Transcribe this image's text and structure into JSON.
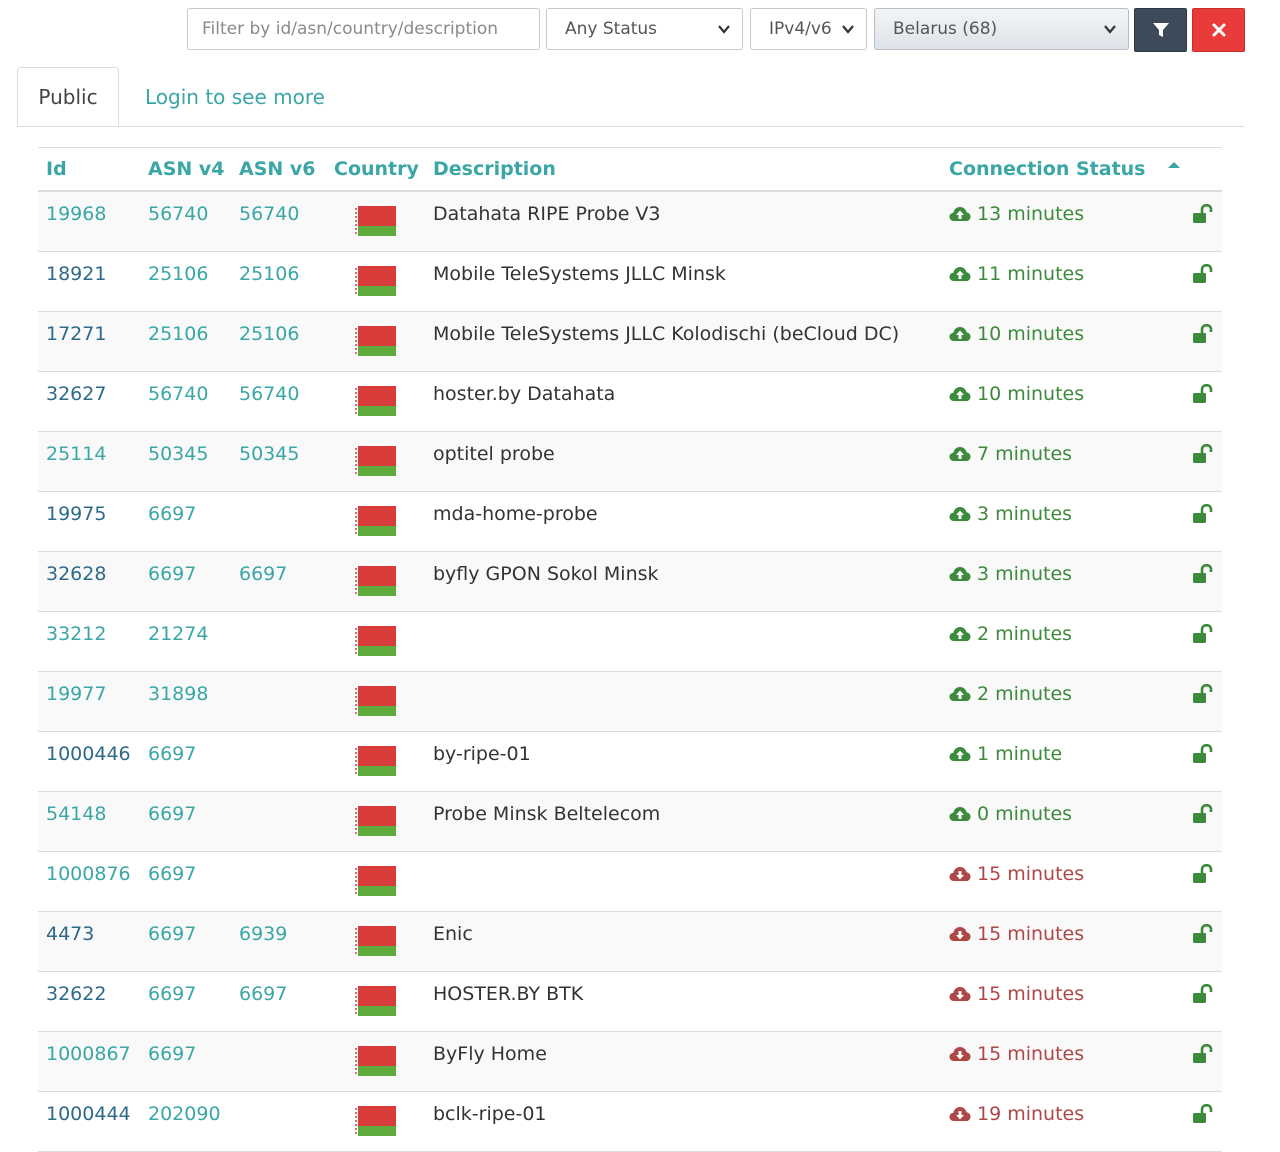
{
  "filters": {
    "search_placeholder": "Filter by id/asn/country/description",
    "status_value": "Any Status",
    "ip_value": "IPv4/v6",
    "country_value": "Belarus (68)"
  },
  "tabs": {
    "public": "Public",
    "login": "Login to see more"
  },
  "table": {
    "headers": {
      "id": "Id",
      "asn_v4": "ASN v4",
      "asn_v6": "ASN v6",
      "country": "Country",
      "description": "Description",
      "connection_status": "Connection Status"
    },
    "rows": [
      {
        "id": "19968",
        "asn_v4": "56740",
        "asn_v6": "56740",
        "description": "Datahata RIPE Probe V3",
        "status": "13 minutes",
        "state": "up",
        "id_style": "light"
      },
      {
        "id": "18921",
        "asn_v4": "25106",
        "asn_v6": "25106",
        "description": "Mobile TeleSystems JLLC Minsk",
        "status": "11 minutes",
        "state": "up",
        "id_style": "dark"
      },
      {
        "id": "17271",
        "asn_v4": "25106",
        "asn_v6": "25106",
        "description": "Mobile TeleSystems JLLC Kolodischi (beCloud DC)",
        "status": "10 minutes",
        "state": "up",
        "id_style": "dark"
      },
      {
        "id": "32627",
        "asn_v4": "56740",
        "asn_v6": "56740",
        "description": "hoster.by Datahata",
        "status": "10 minutes",
        "state": "up",
        "id_style": "dark"
      },
      {
        "id": "25114",
        "asn_v4": "50345",
        "asn_v6": "50345",
        "description": "optitel probe",
        "status": "7 minutes",
        "state": "up",
        "id_style": "light"
      },
      {
        "id": "19975",
        "asn_v4": "6697",
        "asn_v6": "",
        "description": "mda-home-probe",
        "status": "3 minutes",
        "state": "up",
        "id_style": "dark"
      },
      {
        "id": "32628",
        "asn_v4": "6697",
        "asn_v6": "6697",
        "description": "byfly GPON Sokol Minsk",
        "status": "3 minutes",
        "state": "up",
        "id_style": "dark"
      },
      {
        "id": "33212",
        "asn_v4": "21274",
        "asn_v6": "",
        "description": "",
        "status": "2 minutes",
        "state": "up",
        "id_style": "light"
      },
      {
        "id": "19977",
        "asn_v4": "31898",
        "asn_v6": "",
        "description": "",
        "status": "2 minutes",
        "state": "up",
        "id_style": "light"
      },
      {
        "id": "1000446",
        "asn_v4": "6697",
        "asn_v6": "",
        "description": "by-ripe-01",
        "status": "1 minute",
        "state": "up",
        "id_style": "dark"
      },
      {
        "id": "54148",
        "asn_v4": "6697",
        "asn_v6": "",
        "description": "Probe Minsk Beltelecom",
        "status": "0 minutes",
        "state": "up",
        "id_style": "light"
      },
      {
        "id": "1000876",
        "asn_v4": "6697",
        "asn_v6": "",
        "description": "",
        "status": "15 minutes",
        "state": "down",
        "id_style": "light"
      },
      {
        "id": "4473",
        "asn_v4": "6697",
        "asn_v6": "6939",
        "description": "Enic",
        "status": "15 minutes",
        "state": "down",
        "id_style": "dark"
      },
      {
        "id": "32622",
        "asn_v4": "6697",
        "asn_v6": "6697",
        "description": "HOSTER.BY BTK",
        "status": "15 minutes",
        "state": "down",
        "id_style": "dark"
      },
      {
        "id": "1000867",
        "asn_v4": "6697",
        "asn_v6": "",
        "description": "ByFly Home",
        "status": "15 minutes",
        "state": "down",
        "id_style": "light"
      },
      {
        "id": "1000444",
        "asn_v4": "202090",
        "asn_v6": "",
        "description": "bclk-ripe-01",
        "status": "19 minutes",
        "state": "down",
        "id_style": "dark"
      }
    ]
  },
  "icons": {
    "status_up": "cloud-upload-icon",
    "status_down": "cloud-download-icon",
    "lock": "unlock-icon",
    "flag": "belarus-flag-icon"
  },
  "colors": {
    "link": "#3aa6a6",
    "link_dark": "#2d6a8a",
    "status_up": "#3c8a3c",
    "status_down": "#b14646",
    "lock": "#3c8a3c",
    "flag_red": "#d93a3a",
    "flag_green": "#5faa3c",
    "filter_button": "#3c4a5a",
    "clear_button": "#ea3b3b"
  }
}
